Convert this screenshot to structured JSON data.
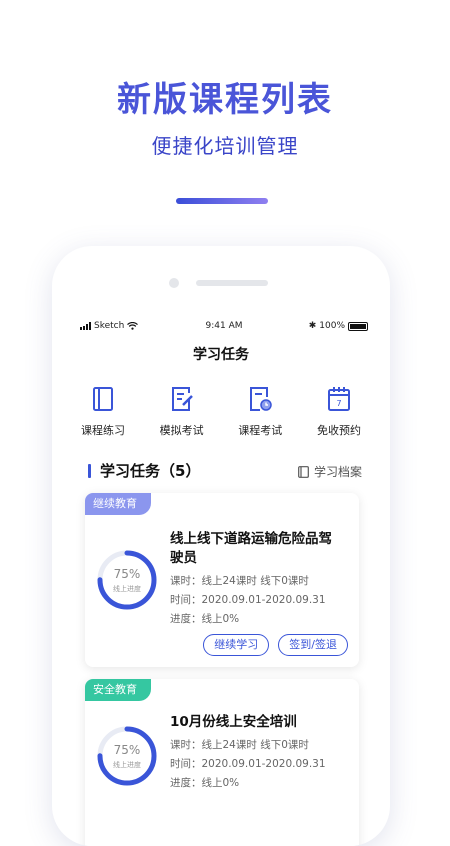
{
  "promo": {
    "title": "新版课程列表",
    "subtitle": "便捷化培训管理"
  },
  "status_bar": {
    "carrier": "Sketch",
    "time": "9:41 AM",
    "battery": "100%"
  },
  "page_title": "学习任务",
  "shortcuts": [
    {
      "label": "课程练习",
      "icon": "book-icon"
    },
    {
      "label": "模拟考试",
      "icon": "edit-document-icon"
    },
    {
      "label": "课程考试",
      "icon": "clock-document-icon"
    },
    {
      "label": "免收预约",
      "icon": "calendar-icon"
    }
  ],
  "section": {
    "title": "学习任务（5）",
    "archive_label": "学习档案"
  },
  "tasks": [
    {
      "tag": "继续教育",
      "tag_color": "#8b96ee",
      "progress": 0.75,
      "progress_text": "75%",
      "progress_label": "线上进度",
      "name_line1": "线上线下道路运输危险品驾",
      "name_line2": "驶员",
      "hours": "课时：线上24课时   线下0课时",
      "time": "时间：2020.09.01-2020.09.31",
      "progress_line": "进度：线上0%",
      "actions": [
        "继续学习",
        "签到/签退"
      ]
    },
    {
      "tag": "安全教育",
      "tag_color": "#35c7a1",
      "progress": 0.75,
      "progress_text": "75%",
      "progress_label": "线上进度",
      "name_line1": "10月份线上安全培训",
      "hours": "课时：线上24课时   线下0课时",
      "time": "时间：2020.09.01-2020.09.31",
      "progress_line": "进度：线上0%"
    }
  ],
  "colors": {
    "accent": "#3a55d8",
    "ring_track": "#e8ebf4"
  }
}
